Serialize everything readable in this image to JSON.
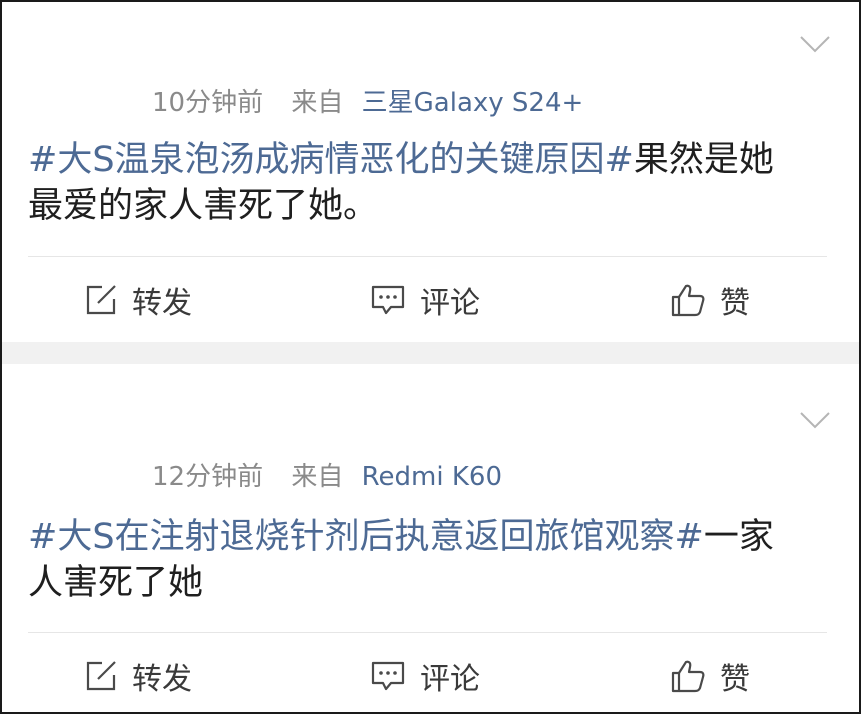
{
  "posts": [
    {
      "time": "10分钟前",
      "from_label": "来自",
      "device": "三星Galaxy S24+",
      "topic": "#大S温泉泡汤成病情恶化的关键原因#",
      "text": "果然是她最爱的家人害死了她。",
      "actions": {
        "repost": "转发",
        "comment": "评论",
        "like": "赞"
      }
    },
    {
      "time": "12分钟前",
      "from_label": "来自",
      "device": "Redmi K60",
      "topic": "#大S在注射退烧针剂后执意返回旅馆观察#",
      "text": "一家人害死了她",
      "actions": {
        "repost": "转发",
        "comment": "评论",
        "like": "赞"
      }
    }
  ],
  "icons": {
    "collapse": "chevron-down-icon",
    "repost": "repost-icon",
    "comment": "comment-icon",
    "like": "thumbs-up-icon"
  },
  "colors": {
    "topic": "#4d6a94",
    "meta": "#8a8a8a",
    "text": "#1f1f1f"
  }
}
